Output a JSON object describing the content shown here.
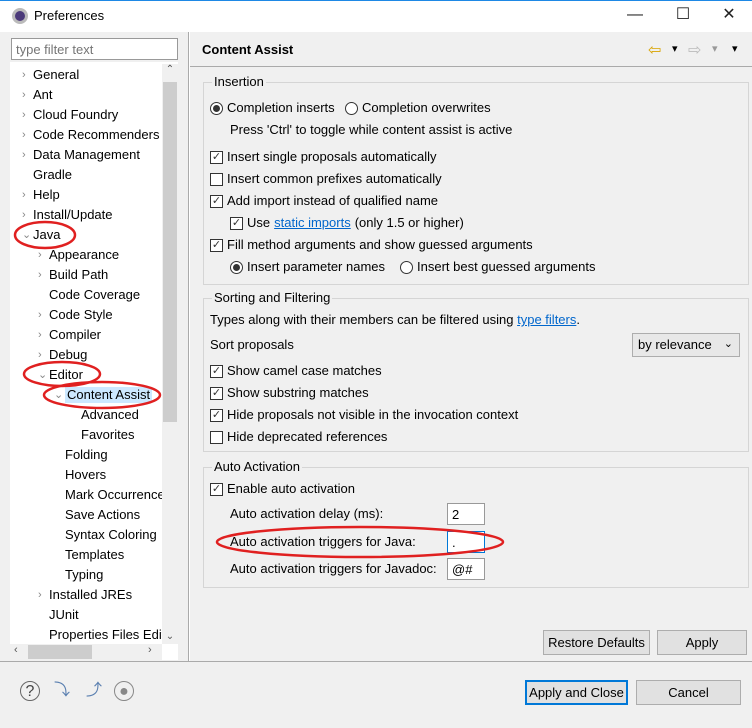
{
  "window": {
    "title": "Preferences",
    "minimize": "—",
    "maximize": "☐",
    "close": "✕"
  },
  "filter": {
    "placeholder": "type filter text"
  },
  "tree": [
    {
      "label": "General",
      "level": 0,
      "arrow": "›"
    },
    {
      "label": "Ant",
      "level": 0,
      "arrow": "›"
    },
    {
      "label": "Cloud Foundry",
      "level": 0,
      "arrow": "›"
    },
    {
      "label": "Code Recommenders",
      "level": 0,
      "arrow": "›"
    },
    {
      "label": "Data Management",
      "level": 0,
      "arrow": "›"
    },
    {
      "label": "Gradle",
      "level": 0,
      "arrow": ""
    },
    {
      "label": "Help",
      "level": 0,
      "arrow": "›"
    },
    {
      "label": "Install/Update",
      "level": 0,
      "arrow": "›"
    },
    {
      "label": "Java",
      "level": 0,
      "arrow": "⌄"
    },
    {
      "label": "Appearance",
      "level": 1,
      "arrow": "›"
    },
    {
      "label": "Build Path",
      "level": 1,
      "arrow": "›"
    },
    {
      "label": "Code Coverage",
      "level": 1,
      "arrow": ""
    },
    {
      "label": "Code Style",
      "level": 1,
      "arrow": "›"
    },
    {
      "label": "Compiler",
      "level": 1,
      "arrow": "›"
    },
    {
      "label": "Debug",
      "level": 1,
      "arrow": "›"
    },
    {
      "label": "Editor",
      "level": 1,
      "arrow": "⌄"
    },
    {
      "label": "Content Assist",
      "level": 2,
      "arrow": "⌄",
      "selected": true
    },
    {
      "label": "Advanced",
      "level": 3,
      "arrow": ""
    },
    {
      "label": "Favorites",
      "level": 3,
      "arrow": ""
    },
    {
      "label": "Folding",
      "level": 2,
      "arrow": ""
    },
    {
      "label": "Hovers",
      "level": 2,
      "arrow": ""
    },
    {
      "label": "Mark Occurrences",
      "level": 2,
      "arrow": ""
    },
    {
      "label": "Save Actions",
      "level": 2,
      "arrow": ""
    },
    {
      "label": "Syntax Coloring",
      "level": 2,
      "arrow": ""
    },
    {
      "label": "Templates",
      "level": 2,
      "arrow": ""
    },
    {
      "label": "Typing",
      "level": 2,
      "arrow": ""
    },
    {
      "label": "Installed JREs",
      "level": 1,
      "arrow": "›"
    },
    {
      "label": "JUnit",
      "level": 1,
      "arrow": ""
    },
    {
      "label": "Properties Files Editor",
      "level": 1,
      "arrow": ""
    }
  ],
  "page": {
    "title": "Content Assist",
    "nav": {
      "back": "⇦",
      "forward": "⇨",
      "menu": "▾"
    },
    "insertion": {
      "label": "Insertion",
      "radio_inserts": "Completion inserts",
      "radio_overwrites": "Completion overwrites",
      "hint": "Press 'Ctrl' to toggle while content assist is active",
      "single_proposals": "Insert single proposals automatically",
      "common_prefixes": "Insert common prefixes automatically",
      "add_import": "Add import instead of qualified name",
      "use": "Use",
      "static_imports": "static imports",
      "static_suffix": "(only 1.5 or higher)",
      "fill_args": "Fill method arguments and show guessed arguments",
      "param_names": "Insert parameter names",
      "best_guessed": "Insert best guessed arguments"
    },
    "sorting": {
      "label": "Sorting and Filtering",
      "desc": "Types along with their members can be filtered using",
      "type_filters": "type filters",
      "desc_end": ".",
      "sort_label": "Sort proposals",
      "sort_value": "by relevance",
      "camel": "Show camel case matches",
      "substring": "Show substring matches",
      "hide_invisible": "Hide proposals not visible in the invocation context",
      "hide_deprecated": "Hide deprecated references"
    },
    "auto": {
      "label": "Auto Activation",
      "enable": "Enable auto activation",
      "delay_label": "Auto activation delay (ms):",
      "delay_value": "2",
      "java_label": "Auto activation triggers for Java:",
      "java_value": ".",
      "javadoc_label": "Auto activation triggers for Javadoc:",
      "javadoc_value": "@#"
    },
    "restore_defaults": "Restore Defaults",
    "apply": "Apply"
  },
  "footer": {
    "apply_close": "Apply and Close",
    "cancel": "Cancel"
  },
  "colors": {
    "accent": "#0078d7",
    "annotation": "#e02020",
    "link": "#0066cc"
  }
}
